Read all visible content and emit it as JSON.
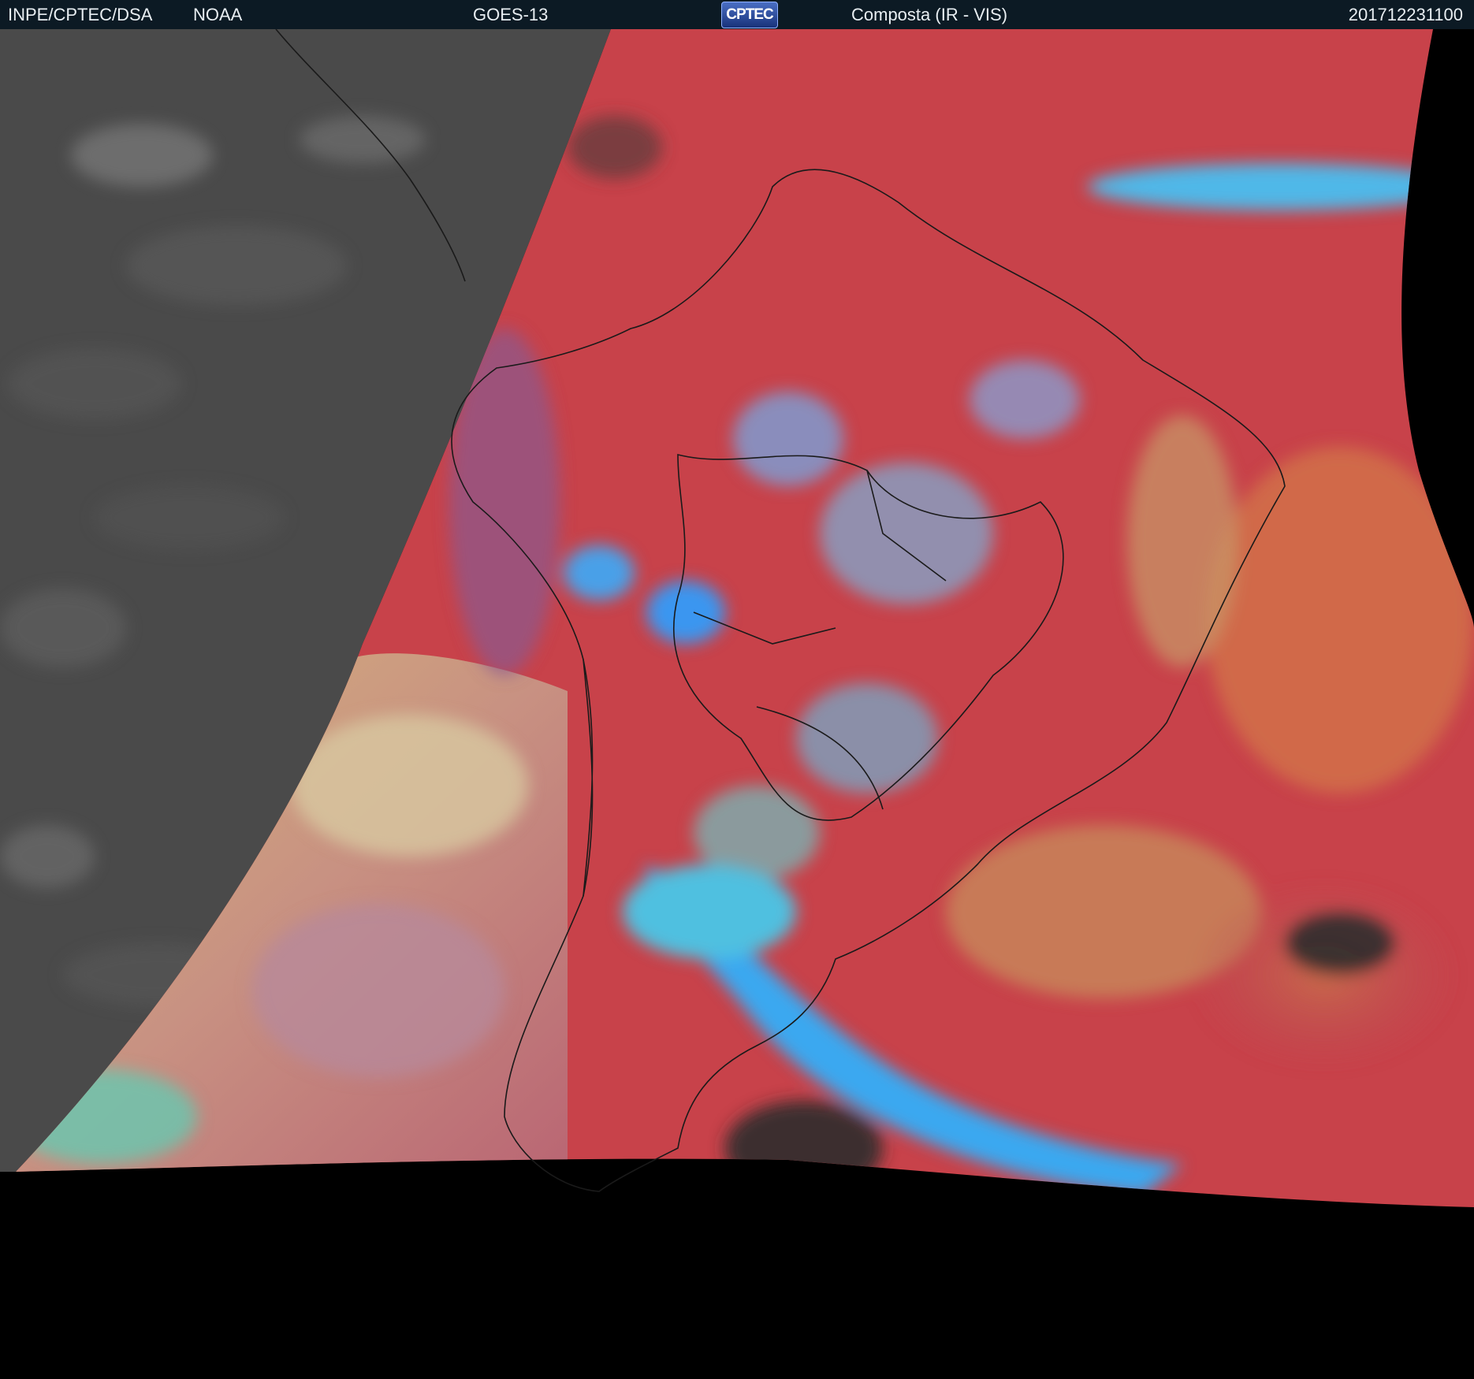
{
  "header": {
    "institution": "INPE/CPTEC/DSA",
    "agency": "NOAA",
    "satellite": "GOES-13",
    "logo_text": "CPTEC",
    "product": "Composta (IR - VIS)",
    "timestamp": "201712231100"
  },
  "image": {
    "region": "South America",
    "colors": {
      "ir_background": "#4a4a4a",
      "composite_red": "#c8424a",
      "cold_cloud_cyan": "#3aa6ea",
      "low_cloud_yellow": "#c8c478",
      "no_data": "#000000",
      "borders": "#1a1a1a"
    }
  }
}
